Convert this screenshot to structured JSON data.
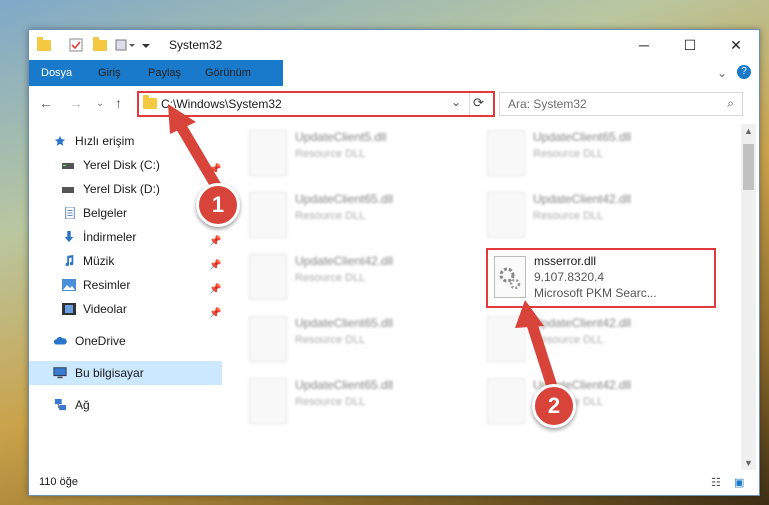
{
  "window": {
    "title": "System32",
    "controls": {
      "minimize": "─",
      "maximize": "☐",
      "close": "✕"
    }
  },
  "ribbon": {
    "tabs": [
      "Dosya",
      "Giriş",
      "Paylaş",
      "Görünüm"
    ]
  },
  "address_bar": {
    "path": "C:\\Windows\\System32",
    "search_placeholder": "Ara: System32"
  },
  "sidebar": {
    "items": [
      {
        "label": "Hızlı erişim",
        "icon": "star-icon"
      },
      {
        "label": "Yerel Disk (C:)",
        "icon": "drive-icon"
      },
      {
        "label": "Yerel Disk (D:)",
        "icon": "drive-icon"
      },
      {
        "label": "Belgeler",
        "icon": "document-icon"
      },
      {
        "label": "İndirmeler",
        "icon": "download-icon"
      },
      {
        "label": "Müzik",
        "icon": "music-icon"
      },
      {
        "label": "Resimler",
        "icon": "pictures-icon"
      },
      {
        "label": "Videolar",
        "icon": "video-icon"
      },
      {
        "label": "OneDrive",
        "icon": "cloud-icon"
      },
      {
        "label": "Bu bilgisayar",
        "icon": "computer-icon"
      },
      {
        "label": "Ağ",
        "icon": "network-icon"
      }
    ]
  },
  "files": [
    {
      "name": "UpdateClient5.dll",
      "desc": "Resource DLL"
    },
    {
      "name": "UpdateClient65.dll",
      "desc": "Resource DLL"
    },
    {
      "name": "UpdateClient65.dll",
      "desc": "Resource DLL"
    },
    {
      "name": "UpdateClient42.dll",
      "desc": "Resource DLL"
    },
    {
      "name": "UpdateClient42.dll",
      "desc": "Resource DLL"
    },
    {
      "name": "UpdateClient65.dll",
      "desc": "Resource DLL"
    },
    {
      "name": "UpdateClient42.dll",
      "desc": "Resource DLL"
    },
    {
      "name": "UpdateClient65.dll",
      "desc": "Resource DLL"
    },
    {
      "name": "UpdateClient42.dll",
      "desc": "Resource DLL"
    }
  ],
  "highlighted_file": {
    "name": "msserror.dll",
    "version": "9.107.8320.4",
    "desc": "Microsoft PKM Searc..."
  },
  "status": {
    "item_count": "110 öğe"
  },
  "callouts": {
    "one": "1",
    "two": "2"
  },
  "colors": {
    "accent": "#1979ca",
    "highlight": "#e23a3a",
    "selected": "#cce8ff"
  }
}
